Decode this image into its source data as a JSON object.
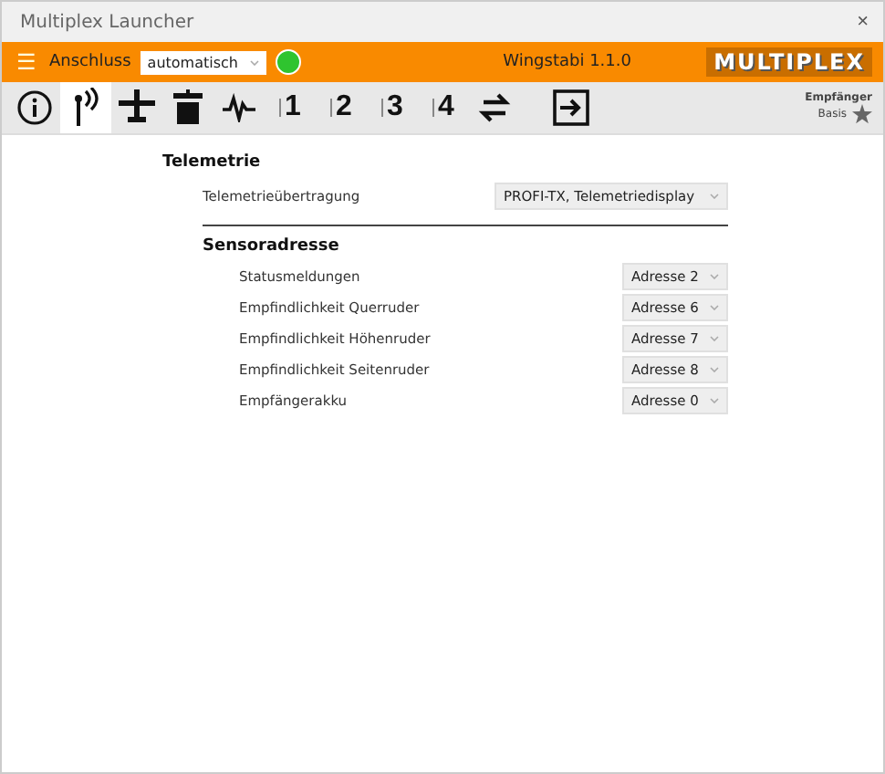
{
  "window": {
    "title": "Multiplex Launcher",
    "close": "×"
  },
  "header": {
    "menu": "☰",
    "connection_label": "Anschluss",
    "connection_value": "automatisch",
    "connected": true,
    "device": "Wingstabi 1.1.0",
    "logo": "MULTIPLEX"
  },
  "tabs": [
    {
      "kind": "info",
      "selected": false
    },
    {
      "kind": "antenna",
      "selected": true
    },
    {
      "kind": "plane",
      "selected": false
    },
    {
      "kind": "receiver",
      "selected": false
    },
    {
      "kind": "wave",
      "selected": false
    },
    {
      "kind": "number",
      "label": "1",
      "selected": false
    },
    {
      "kind": "number",
      "label": "2",
      "selected": false
    },
    {
      "kind": "number",
      "label": "3",
      "selected": false
    },
    {
      "kind": "number",
      "label": "4",
      "selected": false
    },
    {
      "kind": "swap",
      "selected": false
    },
    {
      "kind": "exit",
      "selected": false
    }
  ],
  "mode": {
    "title": "Empfänger",
    "level_label": "Basis"
  },
  "telemetry": {
    "title": "Telemetrie",
    "label": "Telemetrieübertragung",
    "value": "PROFI-TX, Telemetriedisplay"
  },
  "sensors": {
    "title": "Sensoradresse",
    "rows": [
      {
        "label": "Statusmeldungen",
        "value": "Adresse 2"
      },
      {
        "label": "Empfindlichkeit Querruder",
        "value": "Adresse 6"
      },
      {
        "label": "Empfindlichkeit Höhenruder",
        "value": "Adresse 7"
      },
      {
        "label": "Empfindlichkeit Seitenruder",
        "value": "Adresse 8"
      },
      {
        "label": "Empfängerakku",
        "value": "Adresse 0"
      }
    ]
  }
}
